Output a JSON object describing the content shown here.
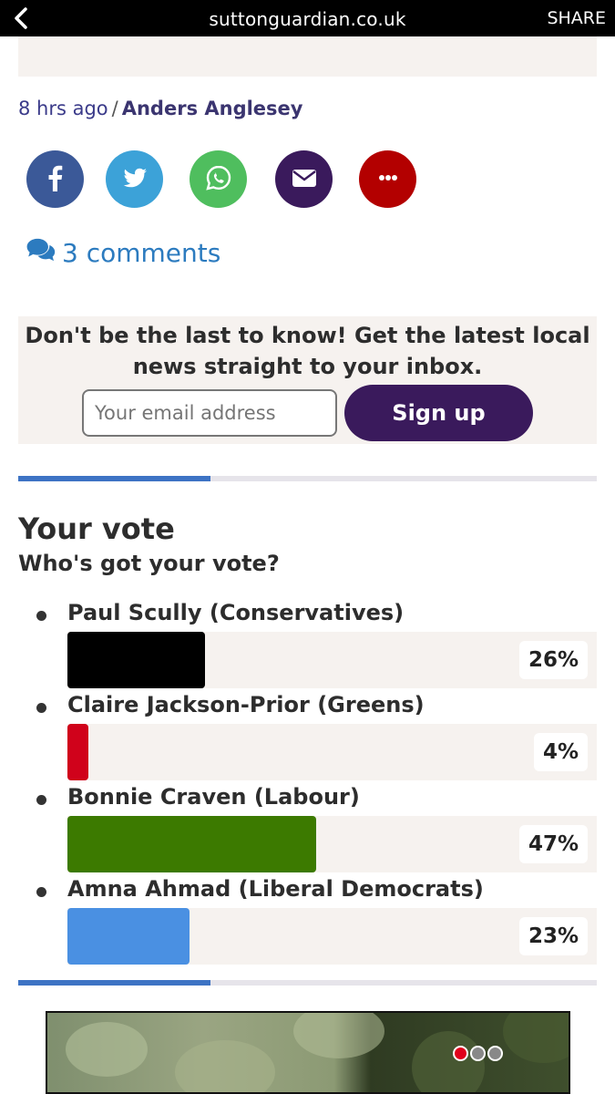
{
  "browser": {
    "back_icon": "chevron-left-icon",
    "domain": "suttonguardian.co.uk",
    "share_label": "SHARE"
  },
  "article": {
    "time_ago": "8 hrs ago",
    "separator": "/",
    "author": "Anders Anglesey"
  },
  "share_buttons": [
    {
      "name": "facebook",
      "icon": "facebook-icon",
      "color": "#3b5998"
    },
    {
      "name": "twitter",
      "icon": "twitter-icon",
      "color": "#3ca2d8"
    },
    {
      "name": "whatsapp",
      "icon": "whatsapp-icon",
      "color": "#4fbe5e"
    },
    {
      "name": "email",
      "icon": "envelope-icon",
      "color": "#3a1a5c"
    },
    {
      "name": "more",
      "icon": "ellipsis-icon",
      "color": "#b30000"
    }
  ],
  "comments": {
    "icon": "comments-icon",
    "label": "3 comments"
  },
  "newsletter": {
    "promo": "Don't be the last to know! Get the latest local news straight to your inbox.",
    "email_placeholder": "Your email address",
    "signup_label": "Sign up"
  },
  "poll": {
    "title": "Your vote",
    "question": "Who's got your vote?",
    "options": [
      {
        "label": "Paul Scully (Conservatives)",
        "percent": 26,
        "percent_text": "26%",
        "color": "#000000"
      },
      {
        "label": "Claire Jackson-Prior (Greens)",
        "percent": 4,
        "percent_text": "4%",
        "color": "#d0021b"
      },
      {
        "label": "Bonnie Craven (Labour)",
        "percent": 47,
        "percent_text": "47%",
        "color": "#3c7a00"
      },
      {
        "label": "Amna Ahmad (Liberal Democrats)",
        "percent": 23,
        "percent_text": "23%",
        "color": "#4a90e2"
      }
    ]
  },
  "ad": {
    "dots_colors": [
      "#e0001b",
      "#888888",
      "#888888"
    ]
  }
}
